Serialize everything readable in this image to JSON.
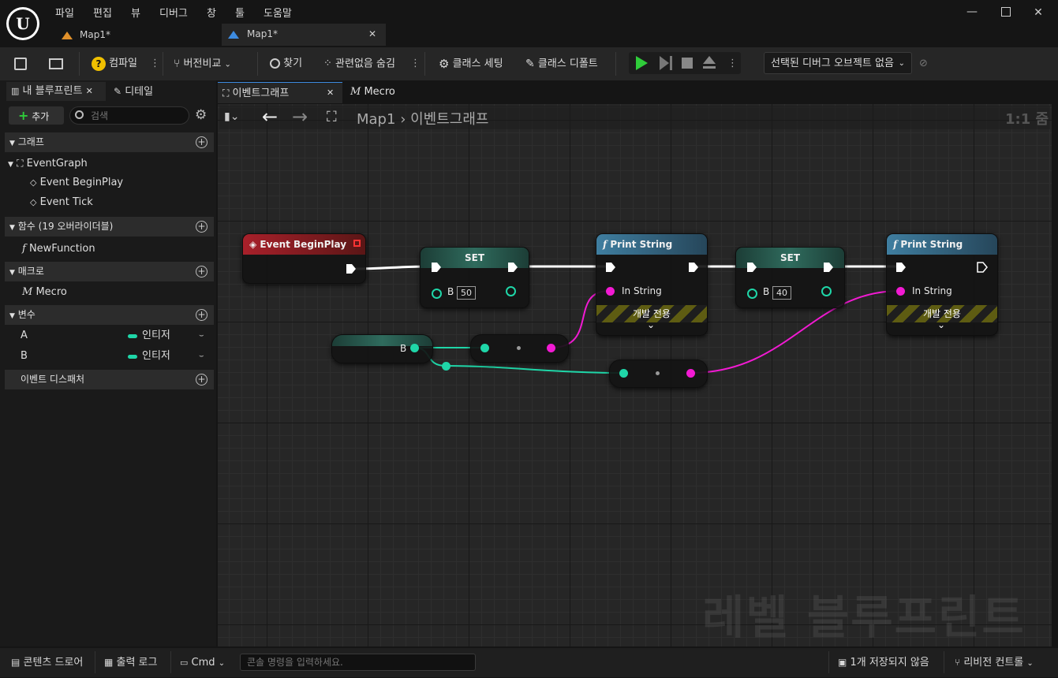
{
  "menu": [
    "파일",
    "편집",
    "뷰",
    "디버그",
    "창",
    "툴",
    "도움말"
  ],
  "doc_tabs": [
    {
      "label": "Map1*",
      "active": false
    },
    {
      "label": "Map1*",
      "active": true
    }
  ],
  "toolbar": {
    "compile": "컴파일",
    "diff": "버전비교",
    "find": "찾기",
    "hide_unrelated": "관련없음 숨김",
    "class_settings": "클래스 세팅",
    "class_defaults": "클래스 디폴트",
    "debug_object": "선택된 디버그 오브젝트 없음"
  },
  "left_panel": {
    "tab_blueprint": "내 블루프린트",
    "tab_details": "디테일",
    "add_label": "추가",
    "search_placeholder": "검색",
    "graphs_header": "그래프",
    "event_graph": "EventGraph",
    "events": [
      "Event BeginPlay",
      "Event Tick"
    ],
    "functions_header": "함수 (19 오버라이더블)",
    "function_item": "NewFunction",
    "macros_header": "매크로",
    "macro_item": "Mecro",
    "variables_header": "변수",
    "variables": [
      {
        "name": "A",
        "type": "인티저"
      },
      {
        "name": "B",
        "type": "인티저"
      }
    ],
    "dispatchers_header": "이벤트 디스패처"
  },
  "graph_tabs": [
    {
      "label": "이벤트그래프",
      "active": true
    },
    {
      "label": "Mecro",
      "active": false
    }
  ],
  "breadcrumb": {
    "root": "Map1",
    "current": "이벤트그래프",
    "zoom": "1:1 줌"
  },
  "nodes": {
    "begin_play": "Event BeginPlay",
    "set1": {
      "title": "SET",
      "var": "B",
      "value": "50"
    },
    "print1": {
      "title": "Print String",
      "in": "In String",
      "dev": "개발 전용"
    },
    "set2": {
      "title": "SET",
      "var": "B",
      "value": "40"
    },
    "print2": {
      "title": "Print String",
      "in": "In String",
      "dev": "개발 전용"
    },
    "getter": {
      "var": "B"
    }
  },
  "watermark": "레벨 블루프린트",
  "statusbar": {
    "content_drawer": "콘텐츠 드로어",
    "output_log": "출력 로그",
    "cmd": "Cmd",
    "console_placeholder": "콘솔 명령을 입력하세요.",
    "unsaved": "1개 저장되지 않음",
    "revision": "리비전 컨트롤"
  },
  "colors": {
    "exec": "#ffffff",
    "int_pin": "#1fd6a8",
    "string_pin": "#f21ad3",
    "event_header": "#8d1a1c",
    "func_header": "#3a6f8c",
    "accent": "#00c94a"
  }
}
